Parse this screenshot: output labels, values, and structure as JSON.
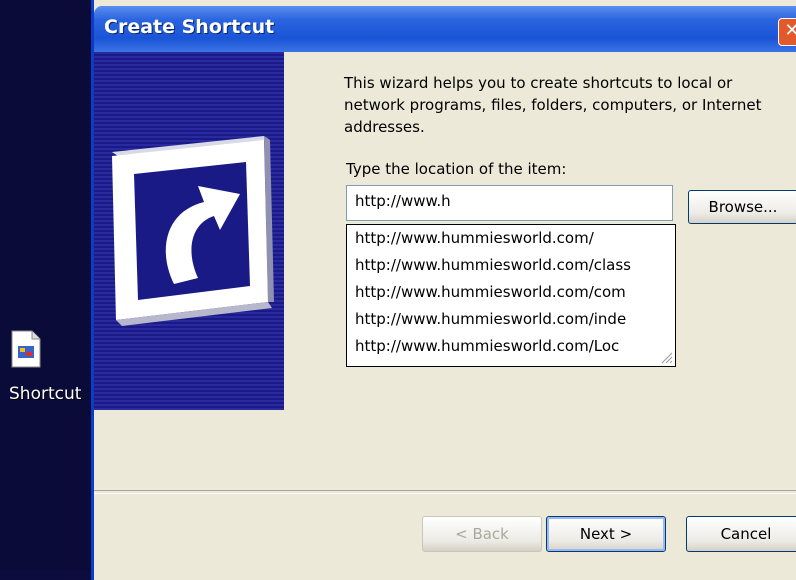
{
  "desktop": {
    "shortcut_label": "Shortcut"
  },
  "window": {
    "title": "Create Shortcut",
    "close_label": "✕",
    "intro_text": "This wizard helps you to create shortcuts to local or\nnetwork programs, files, folders, computers, or Internet\naddresses.",
    "prompt": "Type the location of the item:",
    "location_value": "http://www.h",
    "browse_label": "Browse...",
    "suggestions": [
      "http://www.hummiesworld.com/",
      "http://www.hummiesworld.com/class",
      "http://www.hummiesworld.com/com",
      "http://www.hummiesworld.com/inde",
      "http://www.hummiesworld.com/Loc"
    ],
    "buttons": {
      "back": "< Back",
      "next": "Next >",
      "cancel": "Cancel"
    }
  }
}
